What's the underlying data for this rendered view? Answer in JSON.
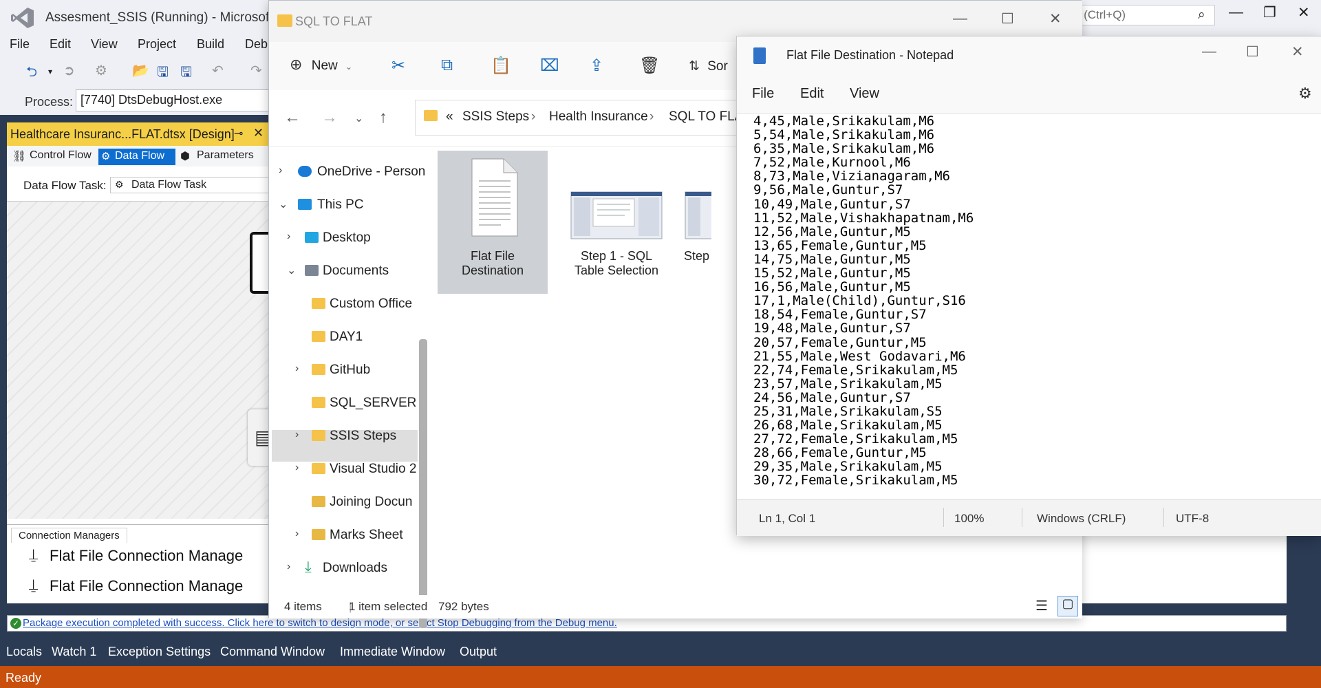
{
  "vs": {
    "title": "Assesment_SSIS (Running) - Microsoft Vi",
    "search_placeholder": "h (Ctrl+Q)",
    "menu": [
      "File",
      "Edit",
      "View",
      "Project",
      "Build",
      "Deb"
    ],
    "process_label": "Process:",
    "process_value": "[7740] DtsDebugHost.exe",
    "doc_tab": "Healthcare Insuranc...FLAT.dtsx [Design]",
    "subtabs": {
      "control_flow": "Control Flow",
      "data_flow": "Data Flow",
      "parameters": "Parameters"
    },
    "task_label": "Data Flow Task:",
    "task_value": "Data Flow Task",
    "conn_header": "Connection Managers",
    "conn_items": [
      "Flat File Connection Manage",
      "Flat File Connection Manage"
    ],
    "info_text": "Package execution completed with success. Click here to switch to design mode, or select Stop Debugging from the Debug menu.",
    "bottom_tabs": [
      "Locals",
      "Watch 1",
      "Exception Settings",
      "Command Window",
      "Immediate Window",
      "Output"
    ],
    "status": "Ready"
  },
  "explorer": {
    "title": "SQL TO FLAT",
    "new_label": "New",
    "sort_label": "Sor",
    "breadcrumb": [
      "«",
      "SSIS Steps",
      "Health Insurance",
      "SQL TO FLAT"
    ],
    "tree": [
      {
        "label": "OneDrive - Person",
        "icon": "cloud-icon"
      },
      {
        "label": "This PC",
        "icon": "monitor-icon"
      },
      {
        "label": "Desktop",
        "icon": "desktop-icon"
      },
      {
        "label": "Documents",
        "icon": "documents-icon"
      },
      {
        "label": "Custom Office",
        "icon": "folder-icon"
      },
      {
        "label": "DAY1",
        "icon": "folder-icon"
      },
      {
        "label": "GitHub",
        "icon": "folder-icon"
      },
      {
        "label": "SQL_SERVER",
        "icon": "folder-icon"
      },
      {
        "label": "SSIS Steps",
        "icon": "folder-icon"
      },
      {
        "label": "Visual Studio 2",
        "icon": "folder-icon"
      },
      {
        "label": "Joining Docun",
        "icon": "folder-icon"
      },
      {
        "label": "Marks Sheet",
        "icon": "folder-icon"
      },
      {
        "label": "Downloads",
        "icon": "download-icon"
      }
    ],
    "files": [
      {
        "line1": "Flat File",
        "line2": "Destination"
      },
      {
        "line1": "Step 1 - SQL",
        "line2": "Table Selection"
      },
      {
        "line1": "Step",
        "line2": ""
      }
    ],
    "status": {
      "count": "4 items",
      "selected": "1 item selected",
      "size": "792 bytes"
    }
  },
  "notepad": {
    "title": "Flat File Destination - Notepad",
    "menu": [
      "File",
      "Edit",
      "View"
    ],
    "lines": [
      "4,45,Male,Srikakulam,M6",
      "5,54,Male,Srikakulam,M6",
      "6,35,Male,Srikakulam,M6",
      "7,52,Male,Kurnool,M6",
      "8,73,Male,Vizianagaram,M6",
      "9,56,Male,Guntur,S7",
      "10,49,Male,Guntur,S7",
      "11,52,Male,Vishakhapatnam,M6",
      "12,56,Male,Guntur,M5",
      "13,65,Female,Guntur,M5",
      "14,75,Male,Guntur,M5",
      "15,52,Male,Guntur,M5",
      "16,56,Male,Guntur,M5",
      "17,1,Male(Child),Guntur,S16",
      "18,54,Female,Guntur,S7",
      "19,48,Male,Guntur,S7",
      "20,57,Female,Guntur,M5",
      "21,55,Male,West Godavari,M6",
      "22,74,Female,Srikakulam,M5",
      "23,57,Male,Srikakulam,M5",
      "24,56,Male,Guntur,S7",
      "25,31,Male,Srikakulam,S5",
      "26,68,Male,Srikakulam,M5",
      "27,72,Female,Srikakulam,M5",
      "28,66,Female,Guntur,M5",
      "29,35,Male,Srikakulam,M5",
      "30,72,Female,Srikakulam,M5"
    ],
    "status": {
      "position": "Ln 1, Col 1",
      "zoom": "100%",
      "eol": "Windows (CRLF)",
      "encoding": "UTF-8"
    }
  }
}
